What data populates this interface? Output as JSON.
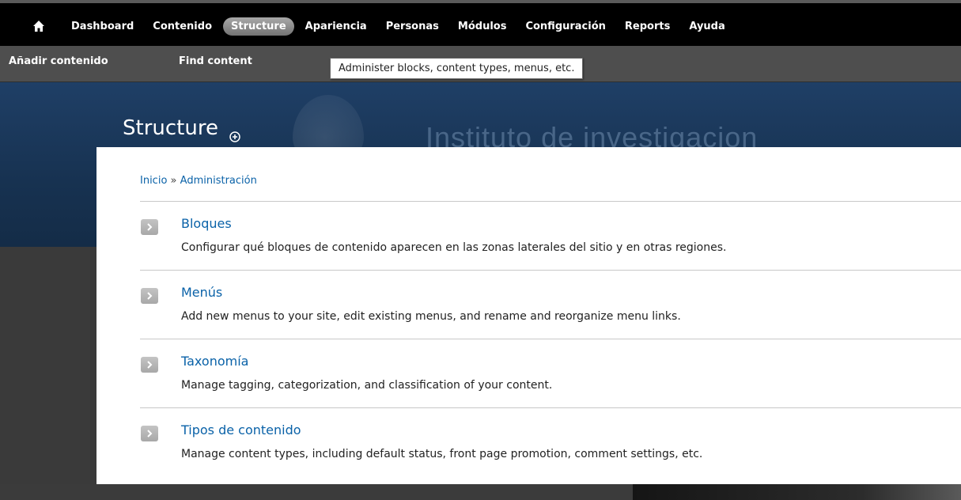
{
  "toolbar": {
    "home_icon": "home-icon",
    "items": [
      {
        "label": "Dashboard"
      },
      {
        "label": "Contenido"
      },
      {
        "label": "Structure"
      },
      {
        "label": "Apariencia"
      },
      {
        "label": "Personas"
      },
      {
        "label": "Módulos"
      },
      {
        "label": "Configuración"
      },
      {
        "label": "Reports"
      },
      {
        "label": "Ayuda"
      }
    ],
    "active_item": "Structure"
  },
  "shortcuts": {
    "add_content": "Añadir contenido",
    "find_content": "Find content"
  },
  "tooltip": "Administer blocks, content types, menus, etc.",
  "header": {
    "title": "Structure",
    "site_name": "Instituto  de  investigacion"
  },
  "breadcrumb": {
    "home": "Inicio",
    "separator": "»",
    "current": "Administración"
  },
  "admin_items": [
    {
      "title": "Bloques",
      "description": "Configurar qué bloques de contenido aparecen en las zonas laterales del sitio y en otras regiones."
    },
    {
      "title": "Menús",
      "description": "Add new menus to your site, edit existing menus, and rename and reorganize menu links."
    },
    {
      "title": "Taxonomía",
      "description": "Manage tagging, categorization, and classification of your content."
    },
    {
      "title": "Tipos de contenido",
      "description": "Manage content types, including default status, front page promotion, comment settings, etc."
    }
  ],
  "colors": {
    "toolbar_bg": "#000000",
    "shortcut_bg": "#4e4e4e",
    "banner_bg": "#173251",
    "link": "#0a62a8"
  }
}
